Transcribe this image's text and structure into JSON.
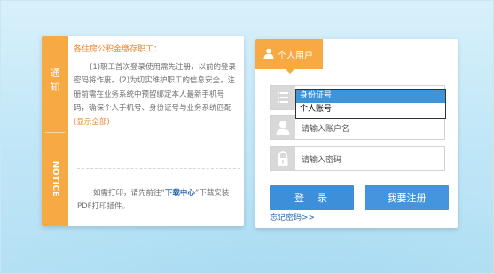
{
  "notice": {
    "tab_cn": "通\n知",
    "tab_en": "NOTICE",
    "title": "各住房公积金缴存职工：",
    "paragraph": "(1)职工首次登录使用需先注册，以前的登录密码将作废。(2)为切实维护职工的信息安全，注册前需在业务系统中预留绑定本人最新手机号码，确保个人手机号、身份证号与业务系统匹配",
    "show_all_link": "(显示全部)",
    "print_before": "如需打印，请先前往“",
    "download_link": "下载中心",
    "print_after": "”下载安装PDF打印插件。"
  },
  "login": {
    "header": "个人用户",
    "account_type_options": [
      "身份证号",
      "个人账号"
    ],
    "account_type_selected": "身份证号",
    "account_placeholder": "请输入账户名",
    "password_placeholder": "请输入密码",
    "login_button": "登　录",
    "register_button": "我要注册",
    "forgot_link": "忘记密码>>"
  },
  "colors": {
    "accent_orange": "#f7a944",
    "button_blue": "#3d8fd9",
    "link_blue": "#2d67b0"
  }
}
